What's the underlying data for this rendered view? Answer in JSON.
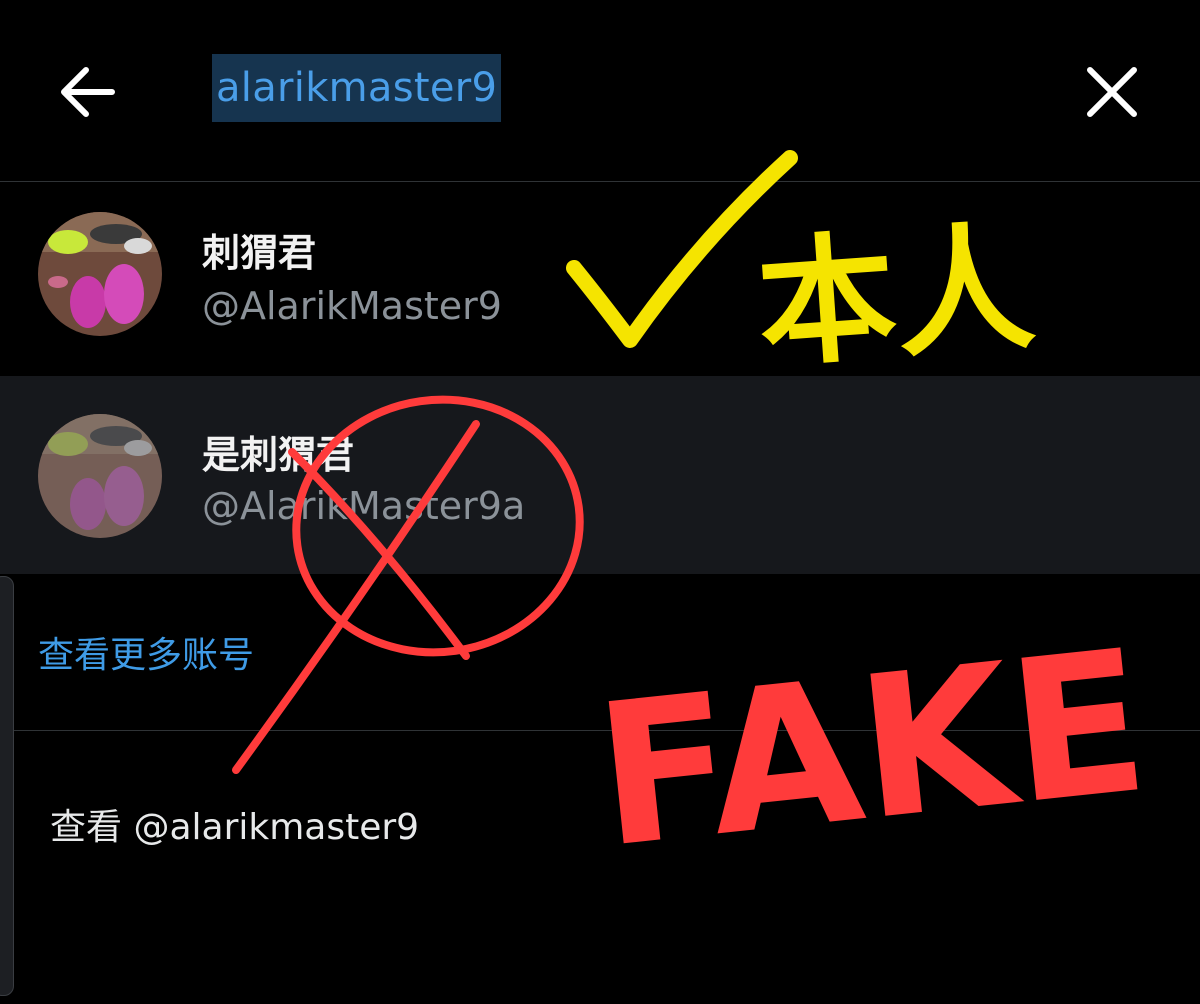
{
  "search": {
    "query": "alarikmaster9"
  },
  "icons": {
    "back": "arrow-left-icon",
    "close": "close-x-icon"
  },
  "results": [
    {
      "name": "刺猬君",
      "handle": "@AlarikMaster9"
    },
    {
      "name": "是刺猬君",
      "handle": "@AlarikMaster9a"
    }
  ],
  "links": {
    "more_accounts": "查看更多账号",
    "view_profile": "查看 @alarikmaster9"
  },
  "annotations": {
    "genuine_label": "本人",
    "fake_label": "FAKE",
    "genuine_color": "#f5e400",
    "fake_color": "#ff3b3b"
  },
  "colors": {
    "background": "#000000",
    "highlight_row": "#16181c",
    "link_blue": "#3f9be6",
    "query_highlight": "#16344f"
  }
}
